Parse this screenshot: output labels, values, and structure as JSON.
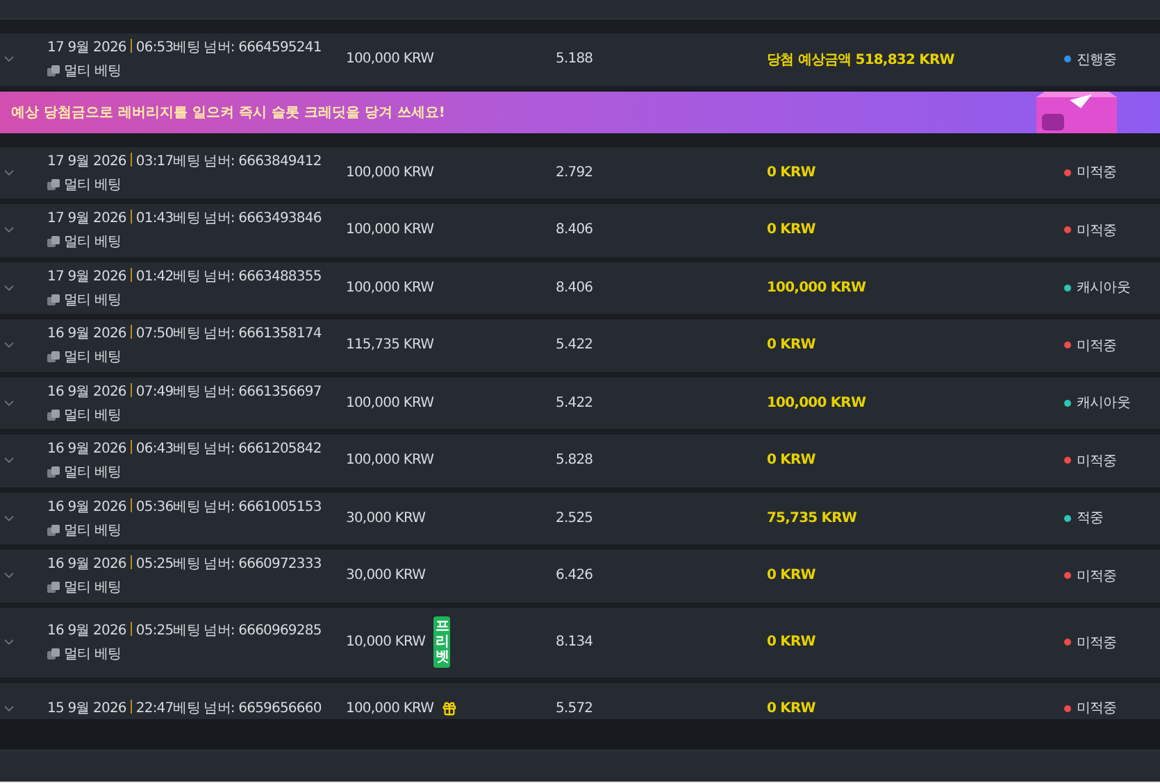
{
  "rows": [
    {
      "date": "17 9월 2026",
      "time": "06:53",
      "bet_number": "베팅 넘버: 6664595241",
      "type": "멀티 베팅",
      "stake": "100,000 KRW",
      "odds": "5.188",
      "payout": "당첨 예상금액 518,832 KRW",
      "status": "진행중",
      "color": "#2d8ff0"
    }
  ],
  "banner": {
    "text": "예상 당첨금으로 레버리지를 일으켜 즉시 슬롯 크레딧을 당겨 쓰세요!"
  },
  "more_rows": [
    {
      "date": "17 9월 2026",
      "time": "03:17",
      "bet_number": "베팅 넘버: 6663849412",
      "type": "멀티 베팅",
      "stake": "100,000 KRW",
      "odds": "2.792",
      "payout": "0 KRW",
      "status": "미적중",
      "color": "#f04a4a"
    },
    {
      "date": "17 9월 2026",
      "time": "01:43",
      "bet_number": "베팅 넘버: 6663493846",
      "type": "멀티 베팅",
      "stake": "100,000 KRW",
      "odds": "8.406",
      "payout": "0 KRW",
      "status": "미적중",
      "color": "#f04a4a"
    },
    {
      "date": "17 9월 2026",
      "time": "01:42",
      "bet_number": "베팅 넘버: 6663488355",
      "type": "멀티 베팅",
      "stake": "100,000 KRW",
      "odds": "8.406",
      "payout": "100,000 KRW",
      "status": "캐시아웃",
      "color": "#2ec4b6"
    },
    {
      "date": "16 9월 2026",
      "time": "07:50",
      "bet_number": "베팅 넘버: 6661358174",
      "type": "멀티 베팅",
      "stake": "115,735 KRW",
      "odds": "5.422",
      "payout": "0 KRW",
      "status": "미적중",
      "color": "#f04a4a"
    },
    {
      "date": "16 9월 2026",
      "time": "07:49",
      "bet_number": "베팅 넘버: 6661356697",
      "type": "멀티 베팅",
      "stake": "100,000 KRW",
      "odds": "5.422",
      "payout": "100,000 KRW",
      "status": "캐시아웃",
      "color": "#2ec4b6"
    },
    {
      "date": "16 9월 2026",
      "time": "06:43",
      "bet_number": "베팅 넘버: 6661205842",
      "type": "멀티 베팅",
      "stake": "100,000 KRW",
      "odds": "5.828",
      "payout": "0 KRW",
      "status": "미적중",
      "color": "#f04a4a"
    },
    {
      "date": "16 9월 2026",
      "time": "05:36",
      "bet_number": "베팅 넘버: 6661005153",
      "type": "멀티 베팅",
      "stake": "30,000 KRW",
      "odds": "2.525",
      "payout": "75,735 KRW",
      "status": "적중",
      "color": "#2ec4b6"
    },
    {
      "date": "16 9월 2026",
      "time": "05:25",
      "bet_number": "베팅 넘버: 6660972333",
      "type": "멀티 베팅",
      "stake": "30,000 KRW",
      "odds": "6.426",
      "payout": "0 KRW",
      "status": "미적중",
      "color": "#f04a4a"
    },
    {
      "date": "16 9월 2026",
      "time": "05:25",
      "bet_number": "베팅 넘버: 6660969285",
      "type": "멀티 베팅",
      "stake": "10,000 KRW",
      "tag": {
        "kind": "freebet",
        "text": "프리벳"
      },
      "odds": "8.134",
      "payout": "0 KRW",
      "status": "미적중",
      "color": "#f04a4a"
    },
    {
      "date": "15 9월 2026",
      "time": "22:47",
      "bet_number": "베팅 넘버: 6659656660",
      "stake": "100,000 KRW",
      "tag": {
        "kind": "gift"
      },
      "odds": "5.572",
      "payout": "0 KRW",
      "status": "미적중",
      "color": "#f04a4a"
    }
  ]
}
